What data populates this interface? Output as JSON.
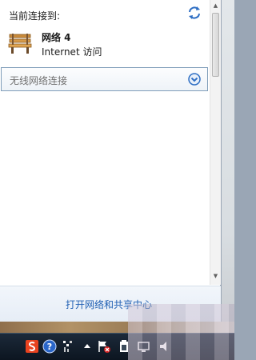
{
  "header": {
    "label": "当前连接到:"
  },
  "connection": {
    "name": "网络  4",
    "status": "Internet 访问"
  },
  "wireless": {
    "label": "无线网络连接"
  },
  "footer": {
    "link_label": "打开网络和共享中心"
  },
  "icons": {
    "refresh": "refresh-icon",
    "network": "bench-network-icon",
    "expand": "chevron-down-circle-icon",
    "tray": [
      "sogou-input-icon",
      "help-icon",
      "pen-icon",
      "show-hidden-icons-arrow",
      "action-center-flag-icon",
      "power-icon",
      "network-monitor-icon",
      "volume-icon"
    ]
  },
  "colors": {
    "link": "#1f5fb3",
    "wireless_border": "#7f9db9",
    "footer_bg": "#e9eff7",
    "taskbar": "#0c1520"
  }
}
